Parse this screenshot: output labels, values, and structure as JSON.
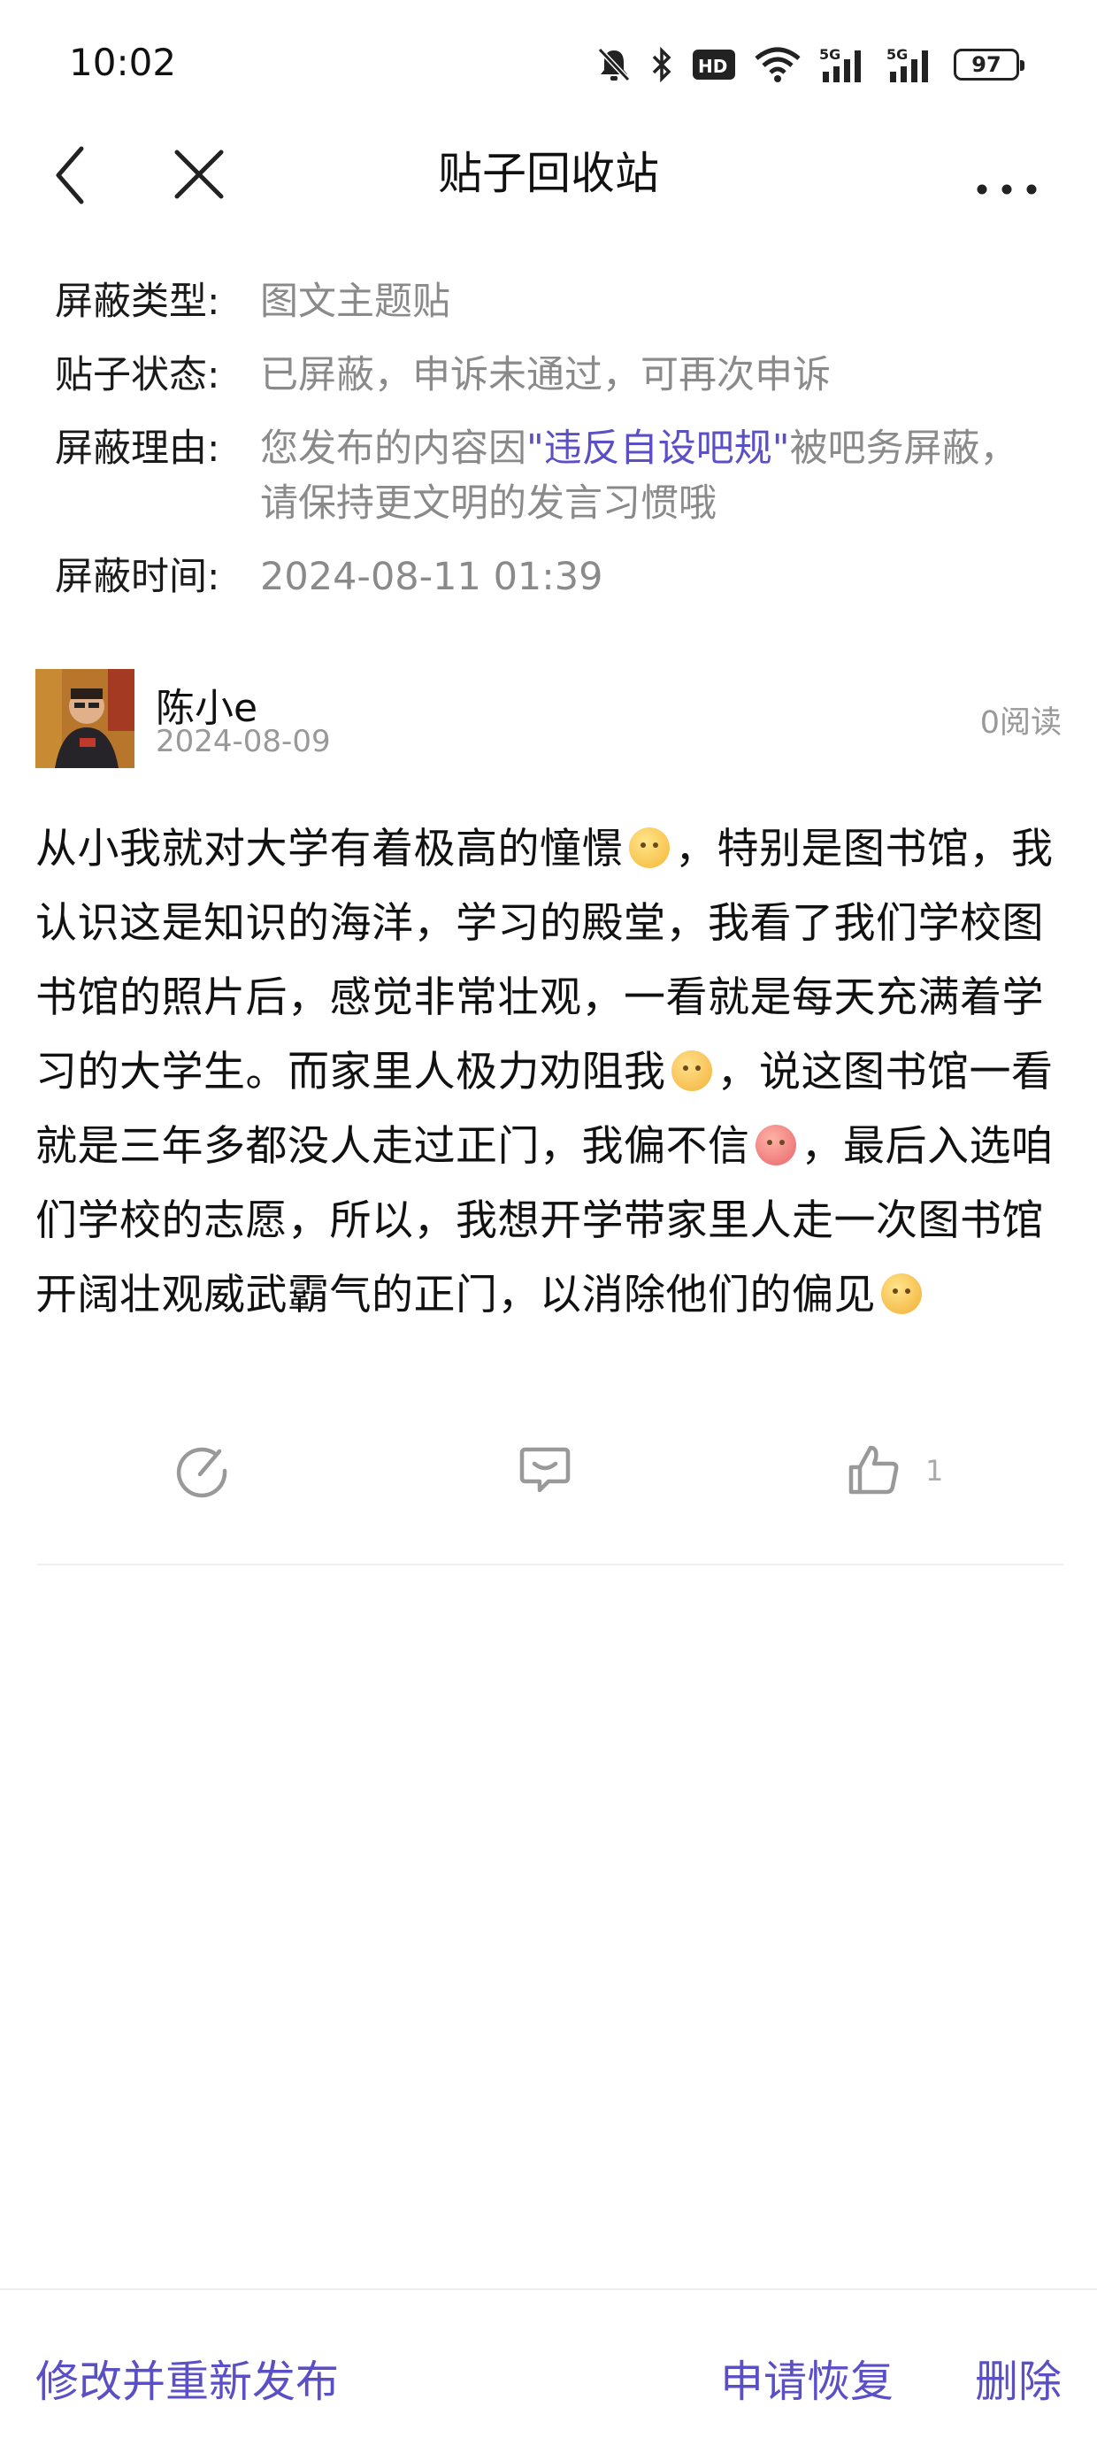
{
  "status_bar": {
    "time": "10:02",
    "battery": "97",
    "icons": [
      "mute-bell-icon",
      "bluetooth-icon",
      "hd-icon",
      "wifi-icon",
      "signal-5g-icon",
      "signal-5g-icon",
      "battery-icon"
    ]
  },
  "nav": {
    "title": "贴子回收站",
    "icons": [
      "back-icon",
      "close-icon",
      "more-icon"
    ]
  },
  "info": {
    "type_label": "屏蔽类型:",
    "type_value": "图文主题贴",
    "status_label": "贴子状态:",
    "status_value": "已屏蔽，申诉未通过，可再次申诉",
    "reason_label": "屏蔽理由:",
    "reason_prefix": "您发布的内容因",
    "reason_highlight": "\"违反自设吧规\"",
    "reason_suffix": "被吧务屏蔽，请保持更文明的发言习惯哦",
    "time_label": "屏蔽时间:",
    "time_value": "2024-08-11 01:39"
  },
  "post": {
    "author": "陈小e",
    "date": "2024-08-09",
    "reads": "0阅读",
    "text_1": "从小我就对大学有着极高的憧憬",
    "text_2": "，特别是图书馆，我认识这是知识的海洋，学习的殿堂，我看了我们学校图书馆的照片后，感觉非常壮观，一看就是每天充满着学习的大学生。而家里人极力劝阻我",
    "text_3": "，说这图书馆一看就是三年多都没人走过正门，我偏不信",
    "text_4": "，最后入选咱们学校的志愿，所以，我想开学带家里人走一次图书馆开阔壮观威武霸气的正门，以消除他们的偏见",
    "emojis": [
      "hug-emoji",
      "unamused-emoji",
      "angry-emoji",
      "thinking-emoji"
    ]
  },
  "actions": {
    "share_icon": "share-icon",
    "comment_icon": "comment-icon",
    "like_icon": "thumbs-up-icon",
    "like_count": "1"
  },
  "bottom": {
    "edit_label": "修改并重新发布",
    "restore_label": "申请恢复",
    "delete_label": "删除"
  },
  "colors": {
    "accent": "#5b4fc6",
    "muted": "#8a8a8a"
  }
}
